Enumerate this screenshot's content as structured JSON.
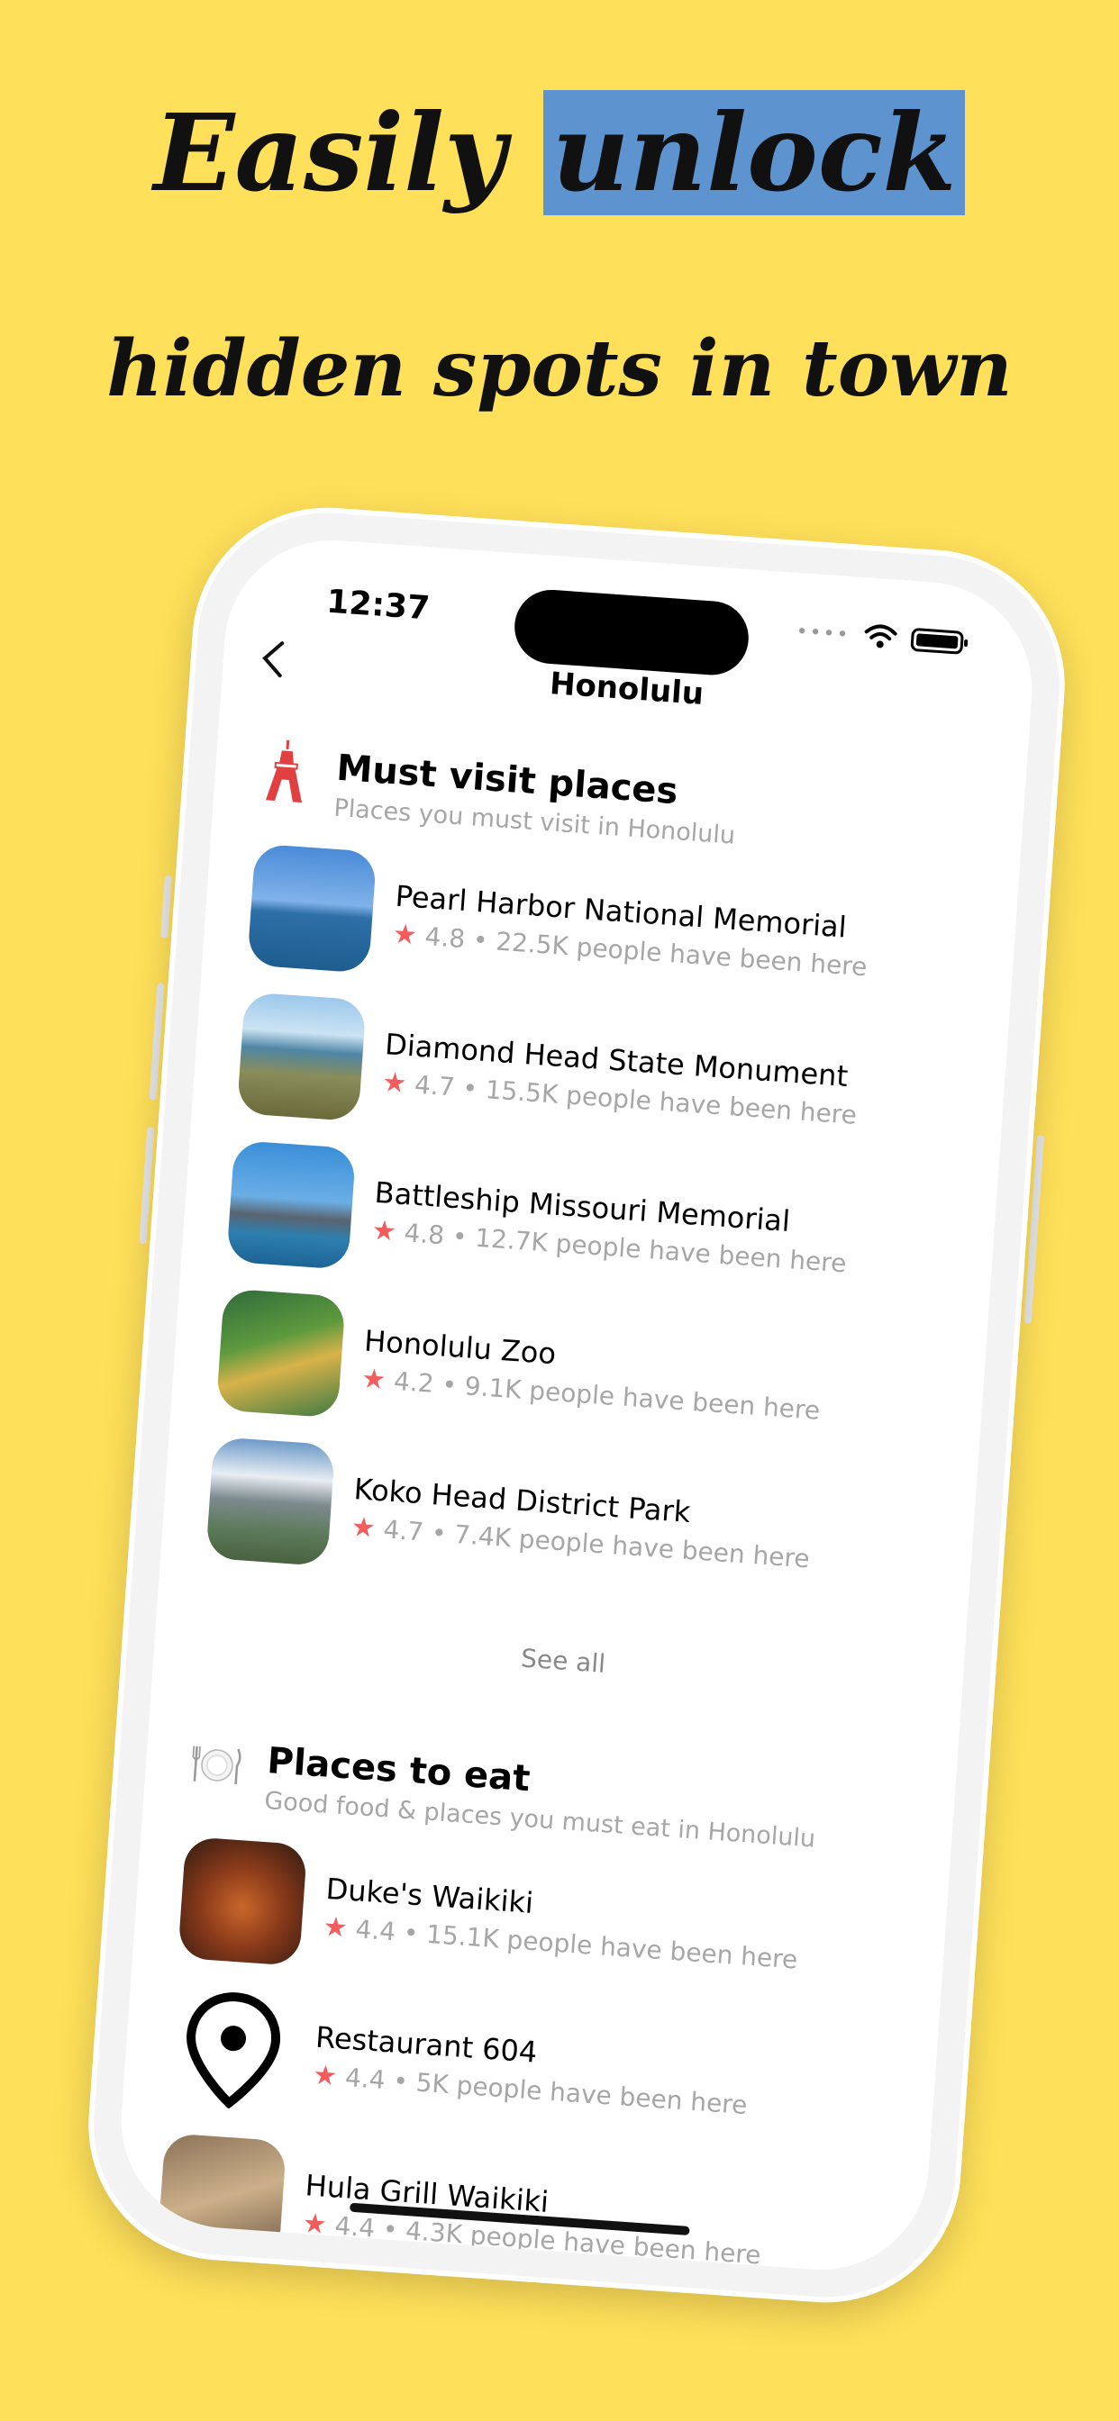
{
  "headline": {
    "line1_prefix": "Easily",
    "line1_highlight": "unlock",
    "line2": "hidden spots in town"
  },
  "colors": {
    "background": "#FFE05A",
    "highlight": "#5D93CF",
    "star": "#F25C5C"
  },
  "status_bar": {
    "time": "12:37"
  },
  "nav": {
    "back_icon": "chevron-left-icon",
    "title": "Honolulu"
  },
  "must_visit": {
    "icon": "tower-icon",
    "title": "Must visit places",
    "subtitle": "Places you must visit in Honolulu",
    "items": [
      {
        "name": "Pearl Harbor National Memorial",
        "rating": "4.8",
        "visitors": "22.5K people have been here"
      },
      {
        "name": "Diamond Head State Monument",
        "rating": "4.7",
        "visitors": "15.5K people have been here"
      },
      {
        "name": "Battleship Missouri Memorial",
        "rating": "4.8",
        "visitors": "12.7K people have been here"
      },
      {
        "name": "Honolulu Zoo",
        "rating": "4.2",
        "visitors": "9.1K people have been here"
      },
      {
        "name": "Koko Head District Park",
        "rating": "4.7",
        "visitors": "7.4K people have been here"
      }
    ],
    "see_all": "See all"
  },
  "places_to_eat": {
    "icon": "plate-icon",
    "title": "Places to eat",
    "subtitle": "Good food & places you must eat in Honolulu",
    "items": [
      {
        "name": "Duke's Waikiki",
        "rating": "4.4",
        "visitors": "15.1K people have been here"
      },
      {
        "name": "Restaurant 604",
        "rating": "4.4",
        "visitors": "5K people have been here"
      },
      {
        "name": "Hula Grill Waikiki",
        "rating": "4.4",
        "visitors": "4.3K people have been here"
      }
    ]
  },
  "separator": "•"
}
